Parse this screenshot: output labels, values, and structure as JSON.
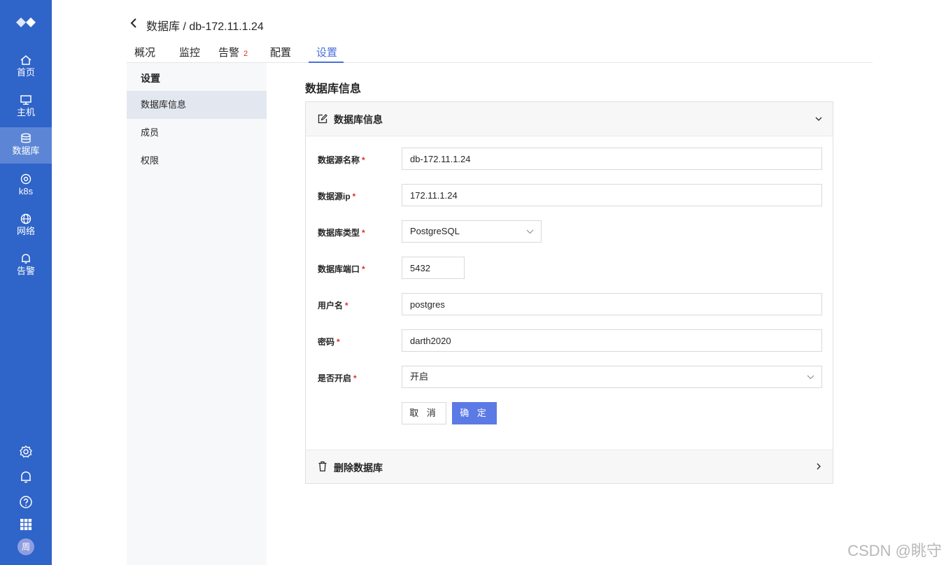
{
  "nav": {
    "items": [
      {
        "label": "首页",
        "icon": "home-icon"
      },
      {
        "label": "主机",
        "icon": "monitor-icon"
      },
      {
        "label": "数据库",
        "icon": "database-icon",
        "active": true
      },
      {
        "label": "k8s",
        "icon": "k8s-icon"
      },
      {
        "label": "网络",
        "icon": "globe-icon"
      },
      {
        "label": "告警",
        "icon": "bell-icon"
      }
    ],
    "bottom_icons": [
      "gear-icon",
      "bell-icon",
      "help-icon",
      "apps-grid-icon"
    ],
    "avatar_text": "周",
    "color": "#2f64c9"
  },
  "header": {
    "breadcrumb": "数据库 / db-172.11.1.24",
    "tabs": [
      {
        "label": "概况"
      },
      {
        "label": "监控"
      },
      {
        "label": "告警",
        "badge": "2"
      },
      {
        "label": "配置"
      },
      {
        "label": "设置",
        "active": true
      }
    ]
  },
  "side_menu": {
    "title": "设置",
    "items": [
      {
        "label": "数据库信息",
        "active": true
      },
      {
        "label": "成员"
      },
      {
        "label": "权限"
      }
    ]
  },
  "main": {
    "section_title": "数据库信息",
    "panel_title": "数据库信息",
    "form": {
      "name_label": "数据源名称",
      "name_value": "db-172.11.1.24",
      "ip_label": "数据源ip",
      "ip_value": "172.11.1.24",
      "type_label": "数据库类型",
      "type_value": "PostgreSQL",
      "port_label": "数据库端口",
      "port_value": "5432",
      "user_label": "用户名",
      "user_value": "postgres",
      "password_label": "密码",
      "password_value": "darth2020",
      "enabled_label": "是否开启",
      "enabled_value": "开启",
      "required_mark": "*"
    },
    "cancel_label": "取 消",
    "ok_label": "确 定",
    "delete_panel_title": "删除数据库",
    "accent_color": "#4a6fdc"
  },
  "watermark": "CSDN @眺守"
}
